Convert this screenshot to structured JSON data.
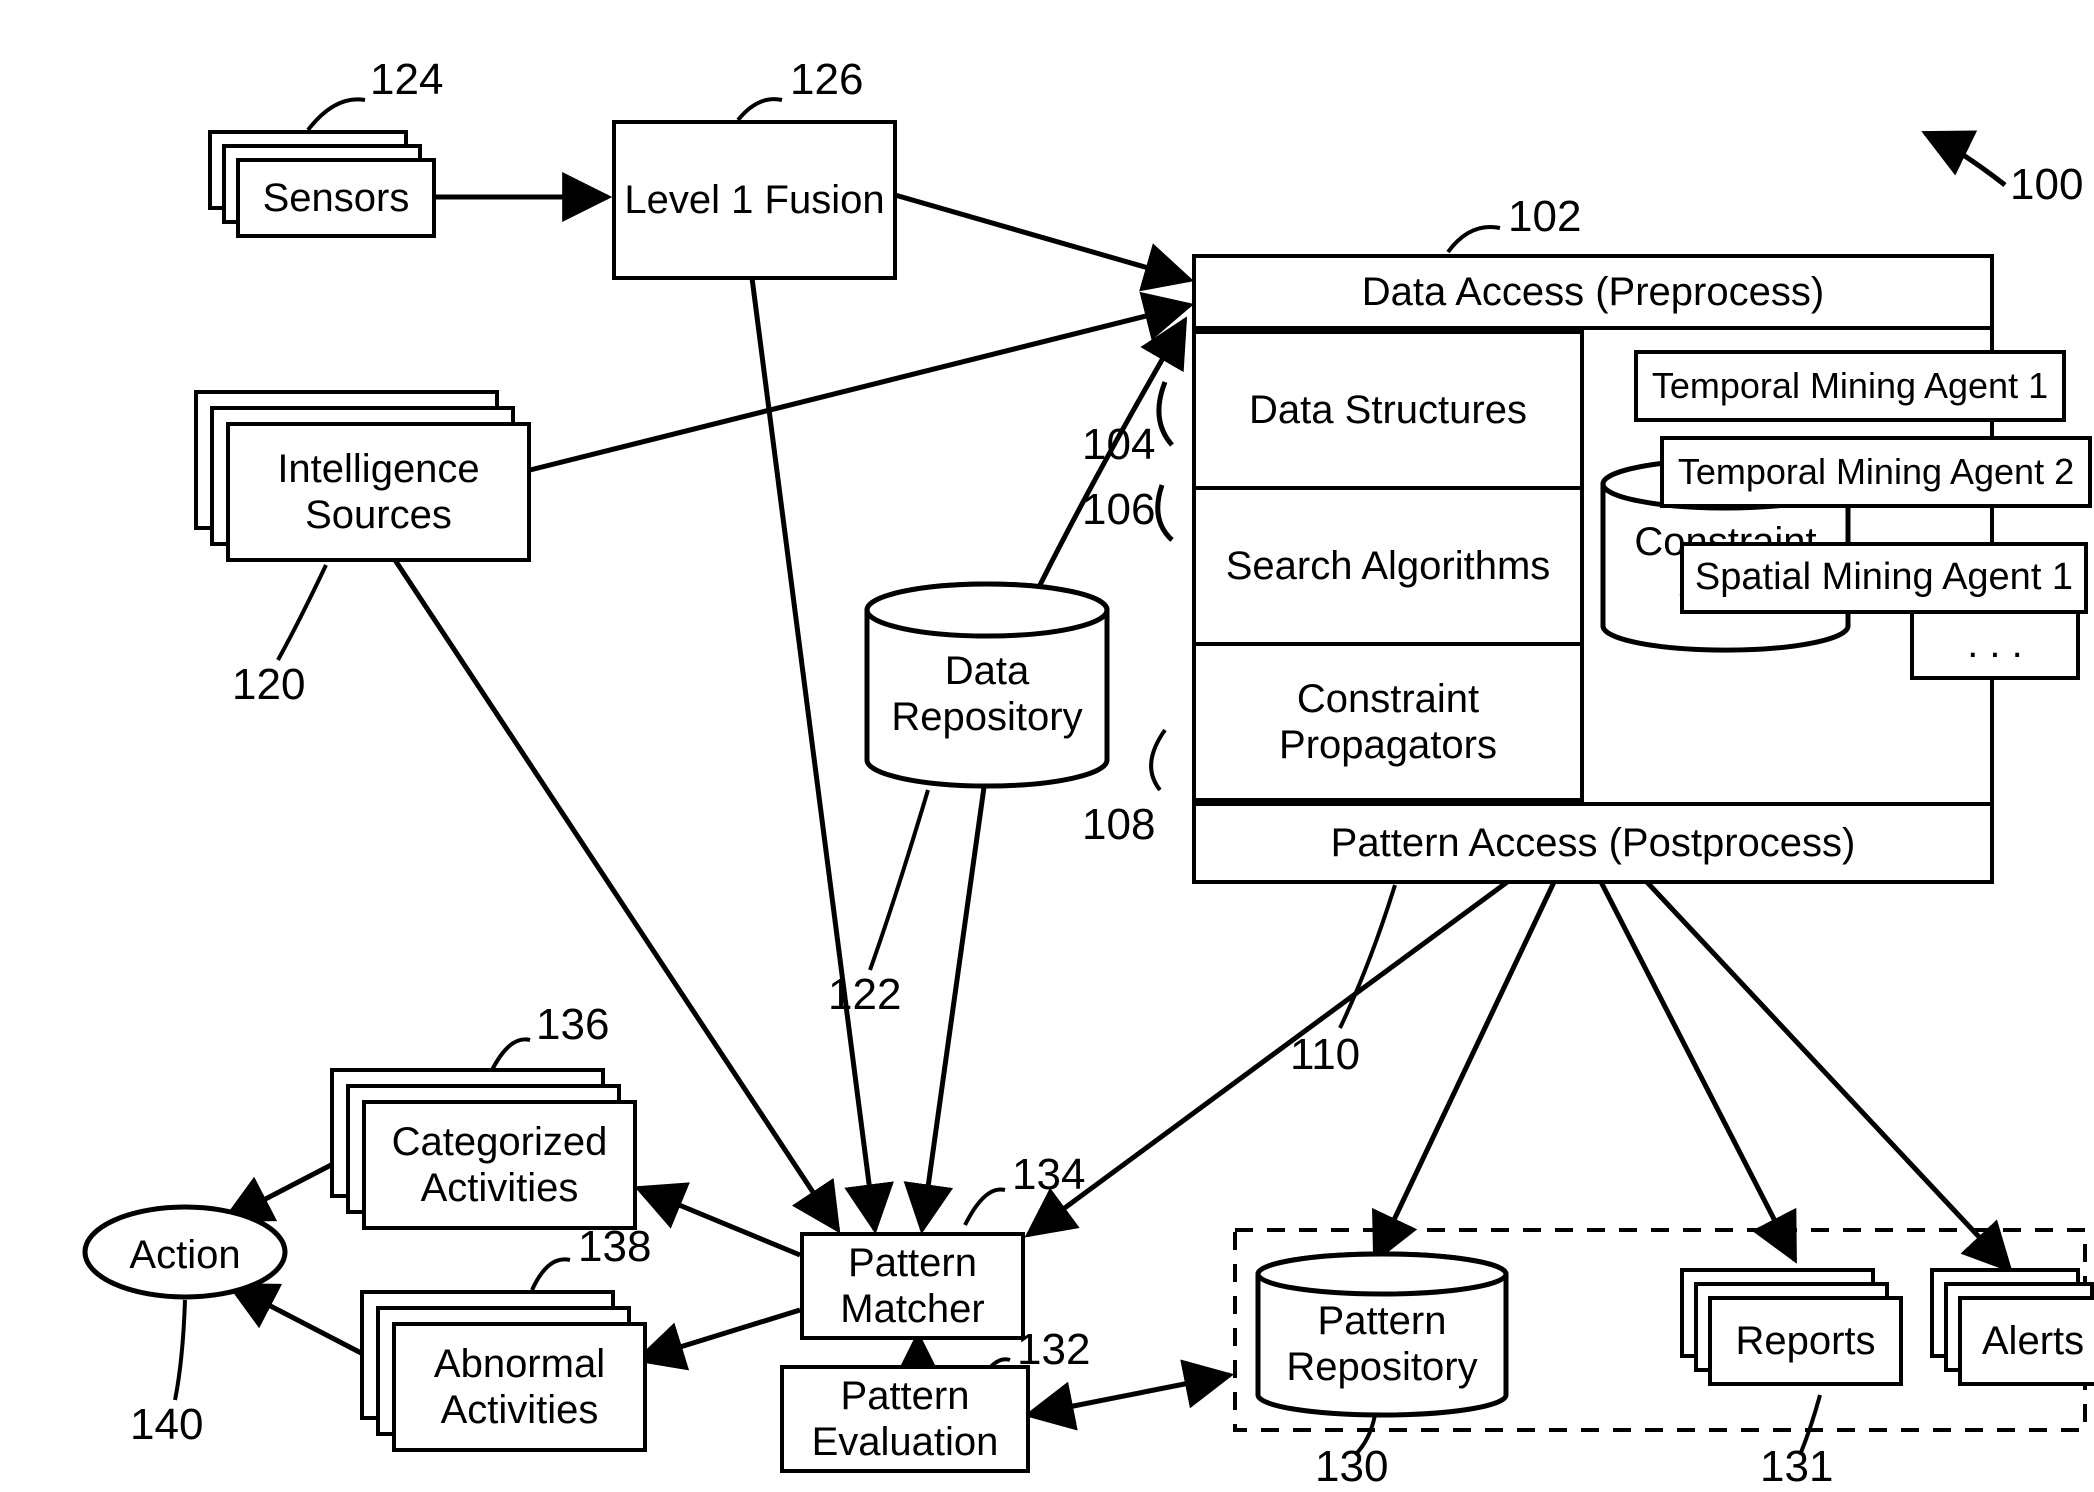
{
  "refs": {
    "n100": "100",
    "n102": "102",
    "n104": "104",
    "n106": "106",
    "n108": "108",
    "n110": "110",
    "n120": "120",
    "n122": "122",
    "n124": "124",
    "n126": "126",
    "n130": "130",
    "n131": "131",
    "n132": "132",
    "n134": "134",
    "n136": "136",
    "n138": "138",
    "n140": "140"
  },
  "labels": {
    "sensors": "Sensors",
    "intel_sources": "Intelligence Sources",
    "level1_fusion": "Level 1 Fusion",
    "data_access": "Data Access (Preprocess)",
    "data_structures": "Data Structures",
    "search_algorithms": "Search Algorithms",
    "constraint_propagators": "Constraint Propagators",
    "constraint_store": "Constraint Store",
    "mining_agent_t1": "Temporal Mining Agent 1",
    "mining_agent_t2": "Temporal Mining Agent 2",
    "mining_agent_s1": "Spatial Mining Agent 1",
    "mining_agent_more": ". . .",
    "pattern_access": "Pattern Access (Postprocess)",
    "data_repository": "Data Repository",
    "categorized_activities": "Categorized Activities",
    "abnormal_activities": "Abnormal Activities",
    "pattern_matcher": "Pattern Matcher",
    "pattern_evaluation": "Pattern Evaluation",
    "pattern_repository": "Pattern Repository",
    "reports": "Reports",
    "alerts": "Alerts",
    "action": "Action"
  }
}
